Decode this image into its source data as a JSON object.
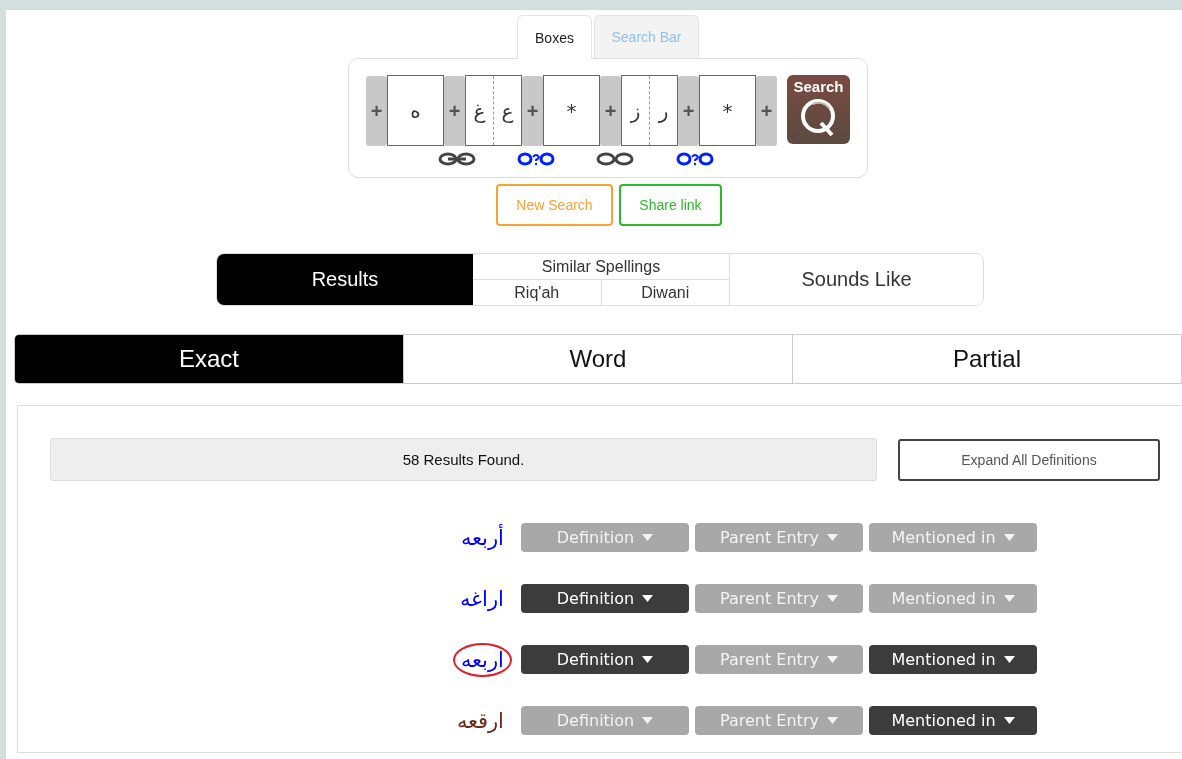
{
  "input_tabs": [
    {
      "label": "Boxes",
      "selected": true
    },
    {
      "label": "Search Bar",
      "selected": false
    }
  ],
  "boxes": [
    {
      "letters": [
        "*"
      ]
    },
    {
      "letters": [
        "ر",
        "ز"
      ]
    },
    {
      "letters": [
        "*"
      ]
    },
    {
      "letters": [
        "ع",
        "غ"
      ]
    },
    {
      "letters": [
        "ه"
      ]
    }
  ],
  "links": [
    {
      "kind": "optional"
    },
    {
      "kind": "unlinked"
    },
    {
      "kind": "optional"
    },
    {
      "kind": "linked"
    }
  ],
  "add_button": "+",
  "search_button": "Search",
  "actions": [
    {
      "label": "New Search",
      "kind": "new"
    },
    {
      "label": "Share link",
      "kind": "share"
    }
  ],
  "result_modes": {
    "results": {
      "label": "Results",
      "selected": true
    },
    "similar_spellings": {
      "label": "Similar Spellings",
      "options": [
        {
          "label": "Riq'ah",
          "selected": false
        },
        {
          "label": "Diwani",
          "selected": false
        }
      ]
    },
    "sounds_like": {
      "label": "Sounds Like",
      "selected": false
    }
  },
  "match_tabs": [
    {
      "label": "Exact",
      "selected": true
    },
    {
      "label": "Word",
      "selected": false
    },
    {
      "label": "Partial",
      "selected": false
    }
  ],
  "result_count": "58 Results Found.",
  "expand_button": "Expand All Definitions",
  "results": [
    {
      "word": "أربعه",
      "color": "#0000ff",
      "circled": false,
      "buttons": [
        {
          "label": "Definition",
          "active": false
        },
        {
          "label": "Parent Entry",
          "active": false
        },
        {
          "label": "Mentioned in",
          "active": false
        }
      ]
    },
    {
      "word": "اراغه",
      "color": "#0000ff",
      "circled": false,
      "buttons": [
        {
          "label": "Definition",
          "active": true
        },
        {
          "label": "Parent Entry",
          "active": false
        },
        {
          "label": "Mentioned in",
          "active": false
        }
      ]
    },
    {
      "word": "اربعه",
      "color": "#0000ff",
      "circled": true,
      "buttons": [
        {
          "label": "Definition",
          "active": true
        },
        {
          "label": "Parent Entry",
          "active": false
        },
        {
          "label": "Mentioned in",
          "active": true
        }
      ]
    },
    {
      "word": "ارقعه",
      "color": "#6b2a1a",
      "circled": false,
      "buttons": [
        {
          "label": "Definition",
          "active": false
        },
        {
          "label": "Parent Entry",
          "active": false
        },
        {
          "label": "Mentioned in",
          "active": true
        }
      ]
    }
  ]
}
